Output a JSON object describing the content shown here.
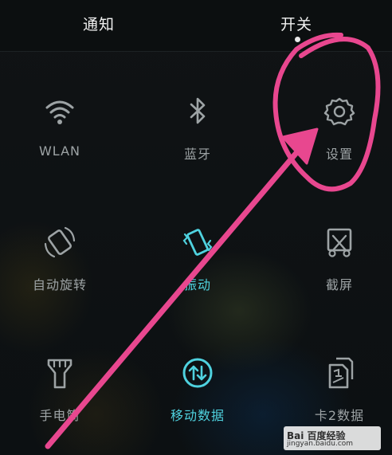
{
  "tabs": {
    "notify": "通知",
    "switches": "开关"
  },
  "tiles": [
    {
      "label": "WLAN",
      "icon": "wifi-icon",
      "active": false
    },
    {
      "label": "蓝牙",
      "icon": "bluetooth-icon",
      "active": false
    },
    {
      "label": "设置",
      "icon": "gear-icon",
      "active": false
    },
    {
      "label": "自动旋转",
      "icon": "rotate-icon",
      "active": false
    },
    {
      "label": "振动",
      "icon": "vibrate-icon",
      "active": true
    },
    {
      "label": "截屏",
      "icon": "screenshot-icon",
      "active": false
    },
    {
      "label": "手电筒",
      "icon": "flashlight-icon",
      "active": false
    },
    {
      "label": "移动数据",
      "icon": "mobile-data-icon",
      "active": true
    },
    {
      "label": "卡2数据",
      "icon": "sim2-data-icon",
      "active": false
    }
  ],
  "colors": {
    "active": "#4fd2df",
    "inactive": "#9da3a5",
    "annotation": "#e8478f"
  },
  "watermark": {
    "logo": "Bai 百度经验",
    "url": "jingyan.baidu.com"
  }
}
